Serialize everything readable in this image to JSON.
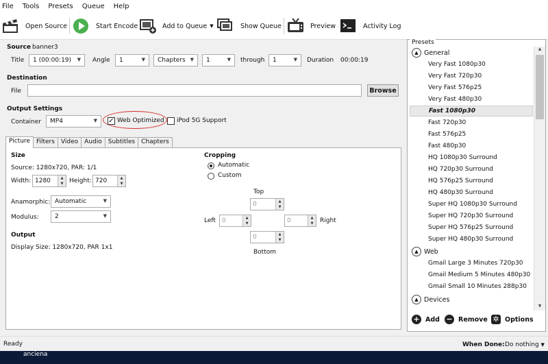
{
  "menu": [
    "File",
    "Tools",
    "Presets",
    "Queue",
    "Help"
  ],
  "toolbar": {
    "open_source": "Open Source",
    "start_encode": "Start Encode",
    "add_to_queue": "Add to Queue",
    "show_queue": "Show Queue",
    "preview": "Preview",
    "activity_log": "Activity Log"
  },
  "source": {
    "label": "Source",
    "name": "banner3",
    "title_label": "Title",
    "title_value": "1 (00:00:19)",
    "angle_label": "Angle",
    "angle_value": "1",
    "mode_value": "Chapters",
    "from_value": "1",
    "through_label": "through",
    "through_value": "1",
    "duration_label": "Duration",
    "duration_value": "00:00:19"
  },
  "destination": {
    "label": "Destination",
    "file_label": "File",
    "file_value": "",
    "browse": "Browse"
  },
  "output_settings": {
    "label": "Output Settings",
    "container_label": "Container",
    "container_value": "MP4",
    "web_optimized": "Web Optimized",
    "web_optimized_checked": "✓",
    "ipod": "iPod 5G Support"
  },
  "tabs": [
    "Picture",
    "Filters",
    "Video",
    "Audio",
    "Subtitles",
    "Chapters"
  ],
  "picture": {
    "size_label": "Size",
    "source_info": "Source:  1280x720, PAR: 1/1",
    "width_label": "Width:",
    "width_value": "1280",
    "height_label": "Height:",
    "height_value": "720",
    "anamorphic_label": "Anamorphic:",
    "anamorphic_value": "Automatic",
    "modulus_label": "Modulus:",
    "modulus_value": "2",
    "output_label": "Output",
    "display_size": "Display Size: 1280x720,  PAR 1x1",
    "cropping_label": "Cropping",
    "crop_auto": "Automatic",
    "crop_custom": "Custom",
    "top_label": "Top",
    "left_label": "Left",
    "right_label": "Right",
    "bottom_label": "Bottom",
    "crop_top": "0",
    "crop_left": "0",
    "crop_right": "0",
    "crop_bottom": "0"
  },
  "presets": {
    "title": "Presets",
    "groups": {
      "general": "General",
      "web": "Web",
      "devices": "Devices"
    },
    "general_items": [
      "Very Fast 1080p30",
      "Very Fast 720p30",
      "Very Fast 576p25",
      "Very Fast 480p30",
      "Fast 1080p30",
      "Fast 720p30",
      "Fast 576p25",
      "Fast 480p30",
      "HQ 1080p30 Surround",
      "HQ 720p30 Surround",
      "HQ 576p25 Surround",
      "HQ 480p30 Surround",
      "Super HQ 1080p30 Surround",
      "Super HQ 720p30 Surround",
      "Super HQ 576p25 Surround",
      "Super HQ 480p30 Surround"
    ],
    "web_items": [
      "Gmail Large 3 Minutes 720p30",
      "Gmail Medium 5 Minutes 480p30",
      "Gmail Small 10 Minutes 288p30"
    ],
    "add": "Add",
    "remove": "Remove",
    "options": "Options"
  },
  "status": {
    "ready": "Ready",
    "when_done_label": "When Done:",
    "when_done_value": "Do nothing"
  },
  "taskbar": {
    "text": "anciena"
  },
  "colors": {
    "accent_red": "#d62c2c",
    "start_green": "#4caf50"
  }
}
